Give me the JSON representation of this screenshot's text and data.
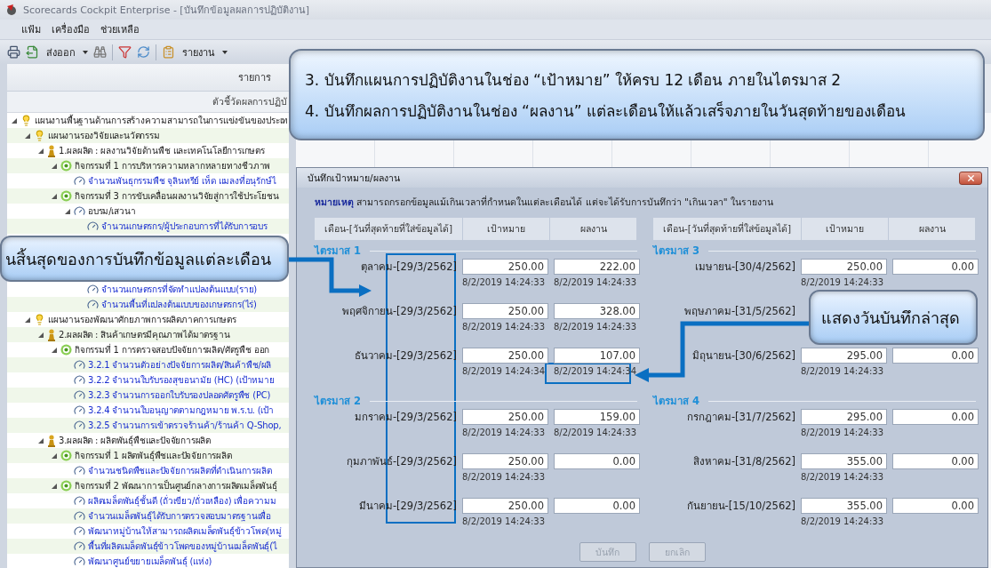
{
  "window": {
    "title": "Scorecards Cockpit Enterprise - [บันทึกข้อมูลผลการปฏิบัติงาน]"
  },
  "menu": [
    "แฟ้ม",
    "เครื่องมือ",
    "ช่วยเหลือ"
  ],
  "toolbar": {
    "export": "ส่งออก",
    "report": "รายงาน"
  },
  "grid": {
    "header": "รายการ",
    "subheader": "ตัวชี้วัดผลการปฏิบั"
  },
  "tree": [
    {
      "kind": "plan",
      "label": "แผนงานพื้นฐานด้านการสร้างความสามารถในการแข่งขันของประเท",
      "expanded": true,
      "children": [
        {
          "kind": "plan",
          "label": "แผนงานรองวิจัยและนวัตกรรม",
          "expanded": true,
          "children": [
            {
              "kind": "output",
              "label": "1.ผลผลิต : ผลงานวิจัยด้านพืช และเทคโนโลยีการเกษตร",
              "expanded": true,
              "children": [
                {
                  "kind": "activity",
                  "label": "กิจกรรมที่ 1  การบริหารความหลากหลายทางชีวภาพ",
                  "expanded": true,
                  "children": [
                    {
                      "kind": "indicator",
                      "label": "จำนวนพันธุกรรมพืช จุลินทรีย์ เห็ด แมลงที่อนุรักษ์ไ"
                    }
                  ]
                },
                {
                  "kind": "activity",
                  "label": "กิจกรรมที่ 3 การขับเคลื่อนผลงานวิจัยสู่การใช้ประโยชน",
                  "expanded": true,
                  "children": [
                    {
                      "kind": "group",
                      "label": "อบรม/เสวนา",
                      "expanded": true,
                      "children": [
                        {
                          "kind": "indicator",
                          "label": "จำนวนเกษตรกร/ผู้ประกอบการที่ได้รับการอบร"
                        },
                        {
                          "kind": "indicator",
                          "label": "จำนวนเกษตรกรที่จัดทำแปลงต้นแบบ(ราย)"
                        },
                        {
                          "kind": "indicator",
                          "label": "จำนวนพื้นที่แปลงต้นแบบของเกษตรกร(ไร่)"
                        }
                      ]
                    }
                  ]
                }
              ]
            }
          ]
        },
        {
          "kind": "plan",
          "label": "แผนงานรองพัฒนาศักยภาพการผลิตภาคการเกษตร",
          "expanded": true,
          "children": [
            {
              "kind": "output",
              "label": "2.ผลผลิต : สินค้าเกษตรมีคุณภาพได้มาตรฐาน",
              "expanded": true,
              "children": [
                {
                  "kind": "activity",
                  "label": "กิจกรรมที่ 1 การตรวจสอบปัจจัยการผลิต/ศัตรูพืช ออก",
                  "expanded": true,
                  "children": [
                    {
                      "kind": "indicator",
                      "label": "3.2.1 จำนวนตัวอย่างปัจจัยการผลิต/สินค้าพืช/ผลิ"
                    },
                    {
                      "kind": "indicator",
                      "label": "3.2.2 จำนวนใบรับรองสุขอนามัย (HC) (เป้าหมาย"
                    },
                    {
                      "kind": "indicator",
                      "label": "3.2.3 จำนวนการออกใบรับรองปลอดศัตรูพืช (PC)"
                    },
                    {
                      "kind": "indicator",
                      "label": "3.2.4 จำนวนใบอนุญาตตามกฎหมาย พ.ร.บ. (เป้า"
                    },
                    {
                      "kind": "indicator",
                      "label": "3.2.5 จำนวนการเข้าตรวจร้านค้า/ร้านค้า Q-Shop,"
                    }
                  ]
                }
              ]
            },
            {
              "kind": "output",
              "label": "3.ผลผลิต : ผลิตพันธุ์พืชและปัจจัยการผลิต",
              "expanded": true,
              "children": [
                {
                  "kind": "activity",
                  "label": "กิจกรรมที่ 1 ผลิตพันธุ์พืชและปัจจัยการผลิต",
                  "expanded": true,
                  "children": [
                    {
                      "kind": "indicator",
                      "label": "จำนวนชนิดพืชและปัจจัยการผลิตที่ดำเนินการผลิต"
                    }
                  ]
                },
                {
                  "kind": "activity",
                  "label": "กิจกรรมที่ 2 พัฒนาการเป็นศูนย์กลางการผลิตเมล็ดพันธุ์",
                  "expanded": true,
                  "children": [
                    {
                      "kind": "indicator",
                      "label": "ผลิตเมล็ดพันธุ์ชั้นดี (ถั่วเขียว/ถั่วเหลือง) เพื่อความม"
                    },
                    {
                      "kind": "indicator",
                      "label": "จำนวนเมล็ดพันธุ์ได้รับการตรวจสอบมาตรฐานเพื่อ"
                    },
                    {
                      "kind": "indicator",
                      "label": "พัฒนาหมู่บ้านให้สามารถผลิตเมล็ดพันธุ์ข้าวโพด(หมู่"
                    },
                    {
                      "kind": "indicator",
                      "label": "พื้นที่ผลิตเมล็ดพันธุ์ข้าวโพดของหมู่บ้านเมล็ดพันธุ์(ไ"
                    },
                    {
                      "kind": "indicator",
                      "label": "พัฒนาศูนย์ขยายเมล็ดพันธุ์ (แห่ง)"
                    }
                  ]
                }
              ]
            }
          ]
        }
      ]
    }
  ],
  "banner": {
    "lines": [
      "3. บันทึกแผนการปฏิบัติงานในช่อง “เป้าหมาย” ให้ครบ 12 เดือน ภายในไตรมาส 2",
      "4. บันทึกผลการปฏิบัติงานในช่อง “ผลงาน” แต่ละเดือนให้แล้วเสร็จภายในวันสุดท้ายของเดือน"
    ]
  },
  "callouts": [
    {
      "text": "นสิ้นสุดของการบันทึกข้อมูลแต่ละเดือน"
    },
    {
      "text": "แสดงวันบันทึกล่าสุด"
    }
  ],
  "dialog": {
    "title": "บันทึกเป้าหมาย/ผลงาน",
    "note": "**หมายเหตุ** สามารถกรอกข้อมูลแม้เกินเวลาที่กำหนดในแต่ละเดือนได้ แต่จะได้รับการบันทึกว่า \"เกินเวลา\" ในรายงาน",
    "panels": [
      {
        "columns": [
          "เดือน-[วันที่สุดท้ายที่ใส่ข้อมูลได้]",
          "เป้าหมาย",
          "ผลงาน"
        ],
        "quarters": [
          {
            "title": "ไตรมาส 1",
            "months": [
              {
                "label": "ตุลาคม-[29/3/2562]",
                "target": "250.00",
                "result": "222.00",
                "target_saved": "8/2/2019 14:24:33",
                "result_saved": "8/2/2019 14:24:33"
              },
              {
                "label": "พฤศจิกายน-[29/3/2562]",
                "target": "250.00",
                "result": "328.00",
                "target_saved": "8/2/2019 14:24:33",
                "result_saved": "8/2/2019 14:24:33"
              },
              {
                "label": "ธันวาคม-[29/3/2562]",
                "target": "250.00",
                "result": "107.00",
                "target_saved": "8/2/2019 14:24:34",
                "result_saved": "8/2/2019 14:24:34"
              }
            ]
          },
          {
            "title": "ไตรมาส 2",
            "months": [
              {
                "label": "มกราคม-[29/3/2562]",
                "target": "250.00",
                "result": "159.00",
                "target_saved": "8/2/2019 14:24:33",
                "result_saved": "8/2/2019 14:24:33"
              },
              {
                "label": "กุมภาพันธ์-[29/3/2562]",
                "target": "250.00",
                "result": "0.00",
                "target_saved": "8/2/2019 14:24:33"
              },
              {
                "label": "มีนาคม-[29/3/2562]",
                "target": "250.00",
                "result": "0.00",
                "target_saved": "8/2/2019 14:24:33"
              }
            ]
          }
        ]
      },
      {
        "columns": [
          "เดือน-[วันที่สุดท้ายที่ใส่ข้อมูลได้]",
          "เป้าหมาย",
          "ผลงาน"
        ],
        "quarters": [
          {
            "title": "ไตรมาส 3",
            "months": [
              {
                "label": "เมษายน-[30/4/2562]",
                "target": "250.00",
                "result": "0.00",
                "target_saved": "8/2/2019 14:24:33"
              },
              {
                "label": "พฤษภาคม-[31/5/2562]"
              },
              {
                "label": "มิถุนายน-[30/6/2562]",
                "target": "295.00",
                "result": "0.00",
                "target_saved": "8/2/2019 14:24:33"
              }
            ]
          },
          {
            "title": "ไตรมาส 4",
            "months": [
              {
                "label": "กรกฎาคม-[31/7/2562]",
                "target": "295.00",
                "result": "0.00",
                "target_saved": "8/2/2019 14:24:33"
              },
              {
                "label": "สิงหาคม-[31/8/2562]",
                "target": "355.00",
                "result": "0.00",
                "target_saved": "8/2/2019 14:24:33"
              },
              {
                "label": "กันยายน-[15/10/2562]",
                "target": "355.00",
                "result": "0.00",
                "target_saved": "8/2/2019 14:24:33"
              }
            ]
          }
        ]
      }
    ],
    "buttons": [
      {
        "label": "บันทึก",
        "disabled": true
      },
      {
        "label": "ยกเลิก",
        "disabled": true
      }
    ]
  }
}
